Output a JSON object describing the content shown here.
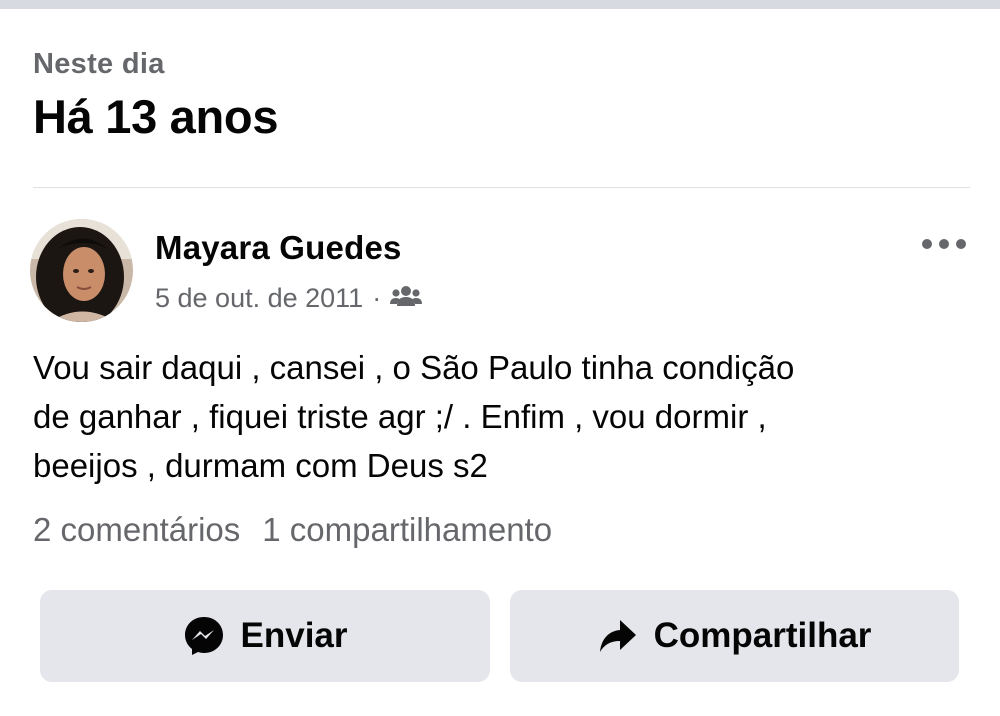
{
  "memories": {
    "label": "Neste dia",
    "title": "Há 13 anos"
  },
  "post": {
    "author": "Mayara Guedes",
    "date": "5 de out. de 2011",
    "separator": "·",
    "audience_icon": "friends-icon",
    "text_lines": [
      "Vou sair daqui , cansei , o São Paulo tinha condição",
      "de ganhar , fiquei triste agr ;/ . Enfim , vou dormir ,",
      "beeijos , durmam com Deus s2"
    ],
    "comments": "2 comentários",
    "shares": "1 compartilhamento"
  },
  "actions": {
    "send_label": "Enviar",
    "send_icon": "messenger-icon",
    "share_label": "Compartilhar",
    "share_icon": "share-arrow-icon"
  },
  "colors": {
    "secondary_text": "#65676b",
    "button_bg": "#e4e6eb"
  }
}
